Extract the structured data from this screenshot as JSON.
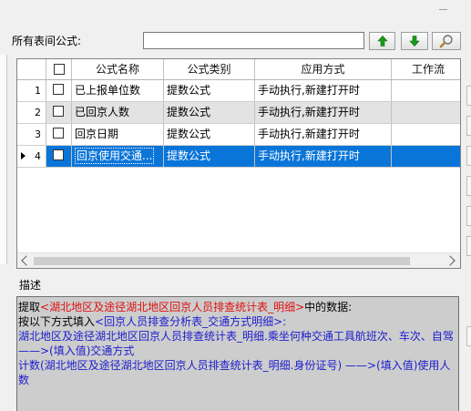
{
  "search": {
    "label": "所有表间公式:",
    "value": ""
  },
  "toolbar": {
    "up_icon": "arrow-up-icon",
    "down_icon": "arrow-down-icon",
    "search_icon": "magnifier-icon",
    "up_color": "#1a9a1a"
  },
  "grid": {
    "headers": [
      "公式名称",
      "公式类别",
      "应用方式",
      "工作流"
    ],
    "rows": [
      {
        "num": "1",
        "name": "已上报单位数",
        "category": "提数公式",
        "mode": "手动执行,新建打开时",
        "workflow": ""
      },
      {
        "num": "2",
        "name": "已回京人数",
        "category": "提数公式",
        "mode": "手动执行,新建打开时",
        "workflow": ""
      },
      {
        "num": "3",
        "name": "回京日期",
        "category": "提数公式",
        "mode": "手动执行,新建打开时",
        "workflow": ""
      },
      {
        "num": "4",
        "name": "回京使用交通...",
        "category": "提数公式",
        "mode": "手动执行,新建打开时",
        "workflow": ""
      }
    ],
    "selected_row": 4,
    "selection_color": "#0a75d9"
  },
  "description": {
    "label": "描述",
    "line1_prefix": "提取",
    "line1_red": "<湖北地区及途径湖北地区回京人员排查统计表_明细>",
    "line1_suffix": "中的数据:",
    "line2_prefix": "按以下方式填入",
    "line2_blue": "<回京人员排查分析表_交通方式明细>",
    "line2_suffix": ":",
    "line3": "湖北地区及途径湖北地区回京人员排查统计表_明细.乘坐何种交通工具航班次、车次、自驾——>(填入值)交通方式",
    "line4": "计数(湖北地区及途径湖北地区回京人员排查统计表_明细.身份证号)  ——>(填入值)使用人数"
  }
}
